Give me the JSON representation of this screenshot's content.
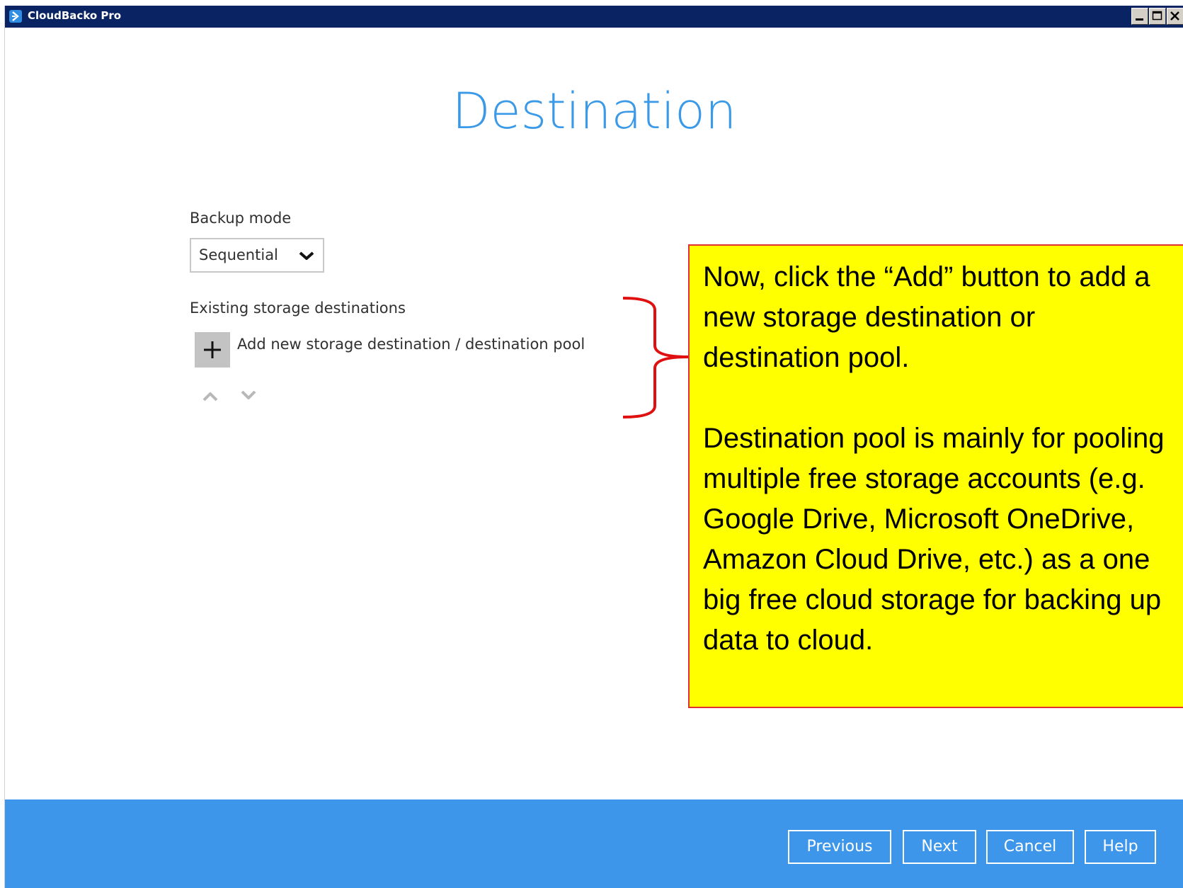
{
  "window": {
    "title": "CloudBacko Pro",
    "controls": [
      "minimize-icon",
      "maximize-icon",
      "close-icon"
    ]
  },
  "page": {
    "title": "Destination"
  },
  "backup_mode": {
    "label": "Backup mode",
    "selected": "Sequential"
  },
  "storage": {
    "label": "Existing storage destinations",
    "add_label": "Add new storage destination / destination pool"
  },
  "callout": {
    "paragraphs": [
      "Now, click the “Add” button to add a new storage destination or destination pool.",
      "Destination pool is mainly for pooling multiple free storage accounts (e.g. Google Drive, Microsoft OneDrive, Amazon Cloud Drive, etc.) as a one big free cloud storage for backing up data to cloud."
    ],
    "background": "#ffff00",
    "border_color": "#e03030"
  },
  "footer": {
    "previous": "Previous",
    "next": "Next",
    "cancel": "Cancel",
    "help": "Help"
  },
  "colors": {
    "titlebar": "#0a2463",
    "accent": "#3a9ae8",
    "footer": "#3d96e9"
  }
}
